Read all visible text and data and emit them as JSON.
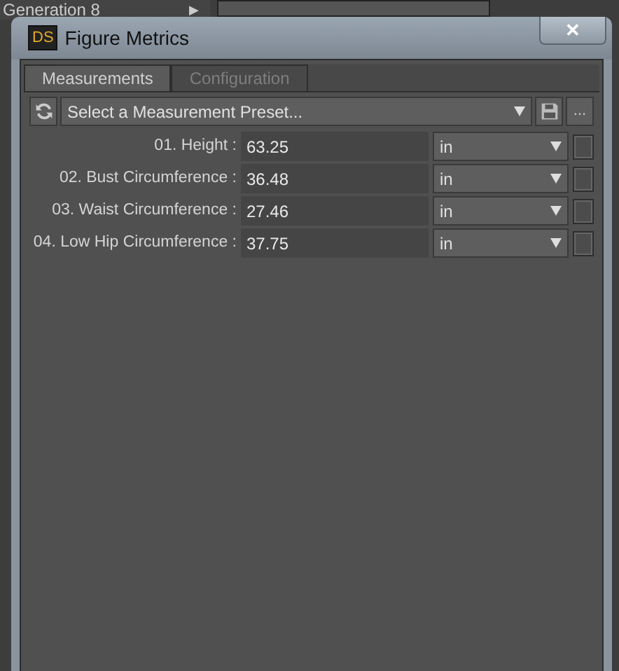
{
  "background": {
    "menu_item": "Generation 8",
    "menu_arrow": "▶"
  },
  "window": {
    "title": "Figure Metrics",
    "logo": "DS",
    "close": "✕"
  },
  "tabs": [
    {
      "label": "Measurements",
      "selected": true
    },
    {
      "label": "Configuration",
      "selected": false
    }
  ],
  "preset": {
    "placeholder": "Select a Measurement Preset...",
    "more": "..."
  },
  "measurements": [
    {
      "label": "01. Height :",
      "value": "63.25",
      "unit": "in",
      "checked": false
    },
    {
      "label": "02. Bust Circumference :",
      "value": "36.48",
      "unit": "in",
      "checked": false
    },
    {
      "label": "03. Waist Circumference :",
      "value": "27.46",
      "unit": "in",
      "checked": false
    },
    {
      "label": "04. Low Hip Circumference :",
      "value": "37.75",
      "unit": "in",
      "checked": false
    }
  ]
}
